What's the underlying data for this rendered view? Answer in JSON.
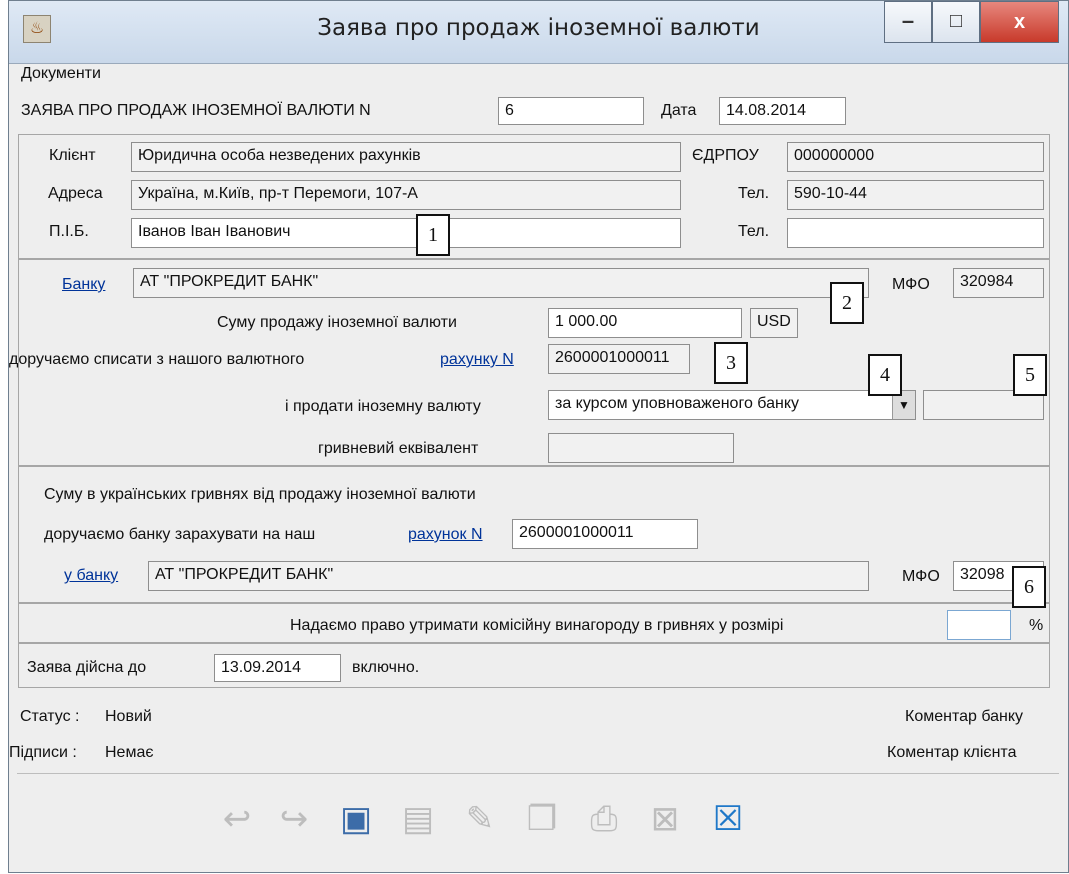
{
  "window": {
    "title": "Заява про продаж іноземної валюти",
    "icon": "java-cup-icon",
    "buttons": {
      "minimize": "–",
      "maximize": "□",
      "close": "x"
    }
  },
  "menu": {
    "documents": "Документи"
  },
  "header": {
    "application_label": "ЗАЯВА ПРО ПРОДАЖ ІНОЗЕМНОЇ ВАЛЮТИ N",
    "application_number": "6",
    "date_label": "Дата",
    "date_value": "14.08.2014"
  },
  "client": {
    "client_label": "Клієнт",
    "client_value": "Юридична особа незведених рахунків",
    "edrpou_label": "ЄДРПОУ",
    "edrpou_value": "000000000",
    "address_label": "Адреса",
    "address_value": "Україна, м.Київ, пр-т Перемоги, 107-А",
    "phone_label": "Тел.",
    "phone_value": "590-10-44",
    "pib_label": "П.І.Б.",
    "pib_value": "Іванов Іван Іванович",
    "phone2_label": "Тел.",
    "phone2_value": ""
  },
  "bank": {
    "bank_link": "Банку",
    "bank_value": "АТ \"ПРОКРЕДИТ БАНК\"",
    "mfo_label": "МФО",
    "mfo_value": "320984",
    "sale_amount_label": "Суму продажу іноземної валюти",
    "sale_amount_value": "1 000.00",
    "currency_value": "USD",
    "debit_label": "доручаємо списати з нашого валютного",
    "debit_link": "рахунку N",
    "debit_account_value": "2600001000011",
    "sell_label": "і продати іноземну валюту",
    "sell_rate_value": "за курсом уповноваженого банку",
    "rate_field_value": "",
    "uah_equivalent_label": "гривневий еквівалент",
    "uah_equivalent_value": ""
  },
  "uah": {
    "line1": "Суму в українських гривнях від продажу іноземної валюти",
    "line2": "доручаємо банку зарахувати на наш",
    "account_link": "рахунок N",
    "account_value": "2600001000011",
    "bank_link": "у банку",
    "bank_value": "АТ \"ПРОКРЕДИТ БАНК\"",
    "mfo_label": "МФО",
    "mfo_value": "32098"
  },
  "commission": {
    "label": "Надаємо право утримати комісійну винагороду в гривнях у розмірі",
    "value": "",
    "unit": "%"
  },
  "validity": {
    "prefix": "Заява дійсна до",
    "date": "13.09.2014",
    "suffix": "включно."
  },
  "status": {
    "status_label": "Статус :",
    "status_value": "Новий",
    "signatures_label": "Підписи :",
    "signatures_value": "Немає",
    "bank_comment": "Коментар банку",
    "client_comment": "Коментар клієнта"
  },
  "callouts": [
    "1",
    "2",
    "3",
    "4",
    "5",
    "6"
  ],
  "toolbar": {
    "items": [
      "undo-icon",
      "redo-icon",
      "save-icon",
      "document-icon",
      "sign-icon",
      "copy-icon",
      "print-icon",
      "delete-icon",
      "close-icon"
    ]
  }
}
